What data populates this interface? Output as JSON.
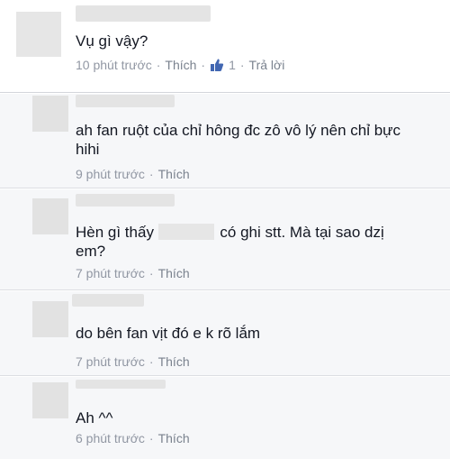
{
  "comments": [
    {
      "text": "Vụ gì vậy?",
      "time": "10 phút trước",
      "like_label": "Thích",
      "like_count": "1",
      "reply_label": "Trả lời"
    },
    {
      "text": "ah fan ruột của chỉ hông đc zô vô lý nên chỉ bực hihi",
      "time": "9 phút trước",
      "like_label": "Thích"
    },
    {
      "text_before": "Hèn gì thấy",
      "text_after": "có ghi stt. Mà tại sao dzị em?",
      "time": "7 phút trước",
      "like_label": "Thích"
    },
    {
      "text": "do bên fan vịt đó e k rõ lắm",
      "time": "7 phút trước",
      "like_label": "Thích"
    },
    {
      "text": "Ah ^^",
      "time": "6 phút trước",
      "like_label": "Thích"
    }
  ],
  "separator": "·",
  "colors": {
    "link": "#7a828e",
    "meta": "#9197a3",
    "like_icon": "#4267b2"
  },
  "icons": {
    "like": "thumbs-up-icon"
  }
}
